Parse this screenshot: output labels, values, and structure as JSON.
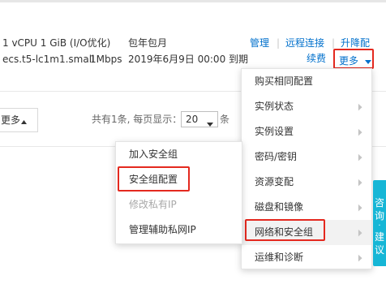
{
  "instance": {
    "spec_line1": "1 vCPU 1 GiB (I/O优化)",
    "spec_line2": "ecs.t5-lc1m1.small",
    "bandwidth": "1Mbps",
    "billing_type": "包年包月",
    "expiry": "2019年6月9日 00:00 到期"
  },
  "actions": {
    "manage": "管理",
    "remote_connect": "远程连接",
    "upgrade": "升降配",
    "renew": "续费",
    "more": "更多",
    "separator": "|"
  },
  "bulk_more_label": "更多",
  "pagination": {
    "total_text": "共有1条, 每页显示：",
    "page_size": "20",
    "unit": "条"
  },
  "more_menu": {
    "items": [
      {
        "label": "购买相同配置",
        "has_submenu": false
      },
      {
        "label": "实例状态",
        "has_submenu": true
      },
      {
        "label": "实例设置",
        "has_submenu": true
      },
      {
        "label": "密码/密钥",
        "has_submenu": true
      },
      {
        "label": "资源变配",
        "has_submenu": true
      },
      {
        "label": "磁盘和镜像",
        "has_submenu": true
      },
      {
        "label": "网络和安全组",
        "has_submenu": true,
        "active": true
      },
      {
        "label": "运维和诊断",
        "has_submenu": true
      }
    ]
  },
  "security_submenu": {
    "items": [
      {
        "label": "加入安全组",
        "disabled": false
      },
      {
        "label": "安全组配置",
        "disabled": false
      },
      {
        "label": "修改私有IP",
        "disabled": true
      },
      {
        "label": "管理辅助私网IP",
        "disabled": false
      }
    ]
  },
  "consult_tab": {
    "chars": [
      "咨",
      "询",
      "建",
      "议"
    ],
    "dot": "·"
  },
  "colors": {
    "link": "#0070cc",
    "highlight": "#e4291f",
    "consult_bg": "#16b6d6"
  },
  "icons": {
    "dropdown_caret": "caret-down-icon",
    "submenu_chevron": "chevron-right-icon",
    "sort_up": "caret-up-icon"
  }
}
